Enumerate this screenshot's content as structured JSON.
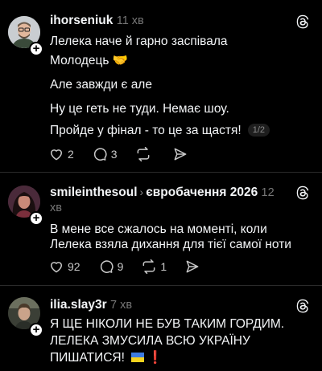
{
  "posts": [
    {
      "username": "ihorseniuk",
      "time": "11 хв",
      "lines": [
        "Лелека наче й гарно заспівала",
        "Молодець 🤝",
        "Але завжди є але",
        "Ну це геть не туди. Немає шоу.",
        "Пройде у фінал - то це за щастя!"
      ],
      "pager": "1/2",
      "likes": "2",
      "replies": "3",
      "reposts": "",
      "avatar_colors": {
        "bg": "#c9cdd1",
        "skin": "#e2b79c",
        "shirt": "#3a4a3a"
      }
    },
    {
      "username": "smileinthesoul",
      "topic": "євробачення 2026",
      "time_line1": "12",
      "time_line2": "хв",
      "lines": [
        "В мене все сжалось на моменті, коли",
        "Лелека взяла дихання для тієї самої ноти"
      ],
      "likes": "92",
      "replies": "9",
      "reposts": "1",
      "avatar_colors": {
        "bg": "#4a2a3a",
        "hair": "#1a0f10",
        "skin": "#c98a78"
      }
    },
    {
      "username": "ilia.slay3r",
      "time": "7 хв",
      "lines": [
        "Я ЩЕ НІКОЛИ НЕ БУВ ТАКИМ ГОРДИМ.",
        "ЛЕЛЕКА ЗМУСИЛА ВСЮ УКРАЇНУ",
        "ПИШАТИСЯ! "
      ],
      "exclamation": "❗",
      "avatar_colors": {
        "bg": "#3b3f36",
        "hair": "#4a3a2a",
        "skin": "#caa38a"
      }
    }
  ],
  "icons": {
    "threads": "threads-logo-icon",
    "like": "heart-icon",
    "reply": "comment-icon",
    "repost": "repost-icon",
    "share": "send-icon",
    "follow": "plus-icon"
  },
  "colors": {
    "background": "#000000",
    "text": "#f3f5f7",
    "muted": "#777777",
    "divider": "#2a2a2a"
  }
}
